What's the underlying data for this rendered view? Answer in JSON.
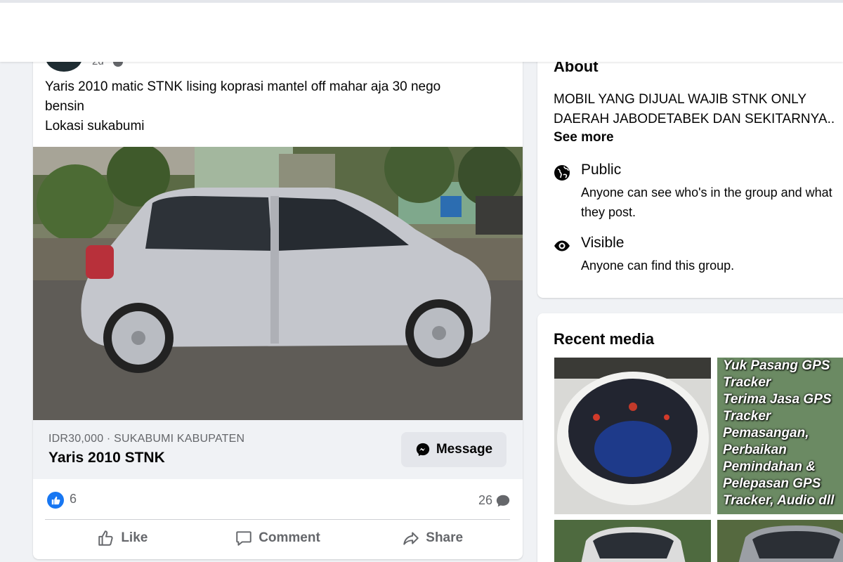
{
  "post": {
    "time": "2d",
    "text_lines": [
      "Yaris 2010 matic STNK lising koprasi mantel off mahar aja 30 nego",
      "bensin",
      "Lokasi sukabumi"
    ],
    "listing": {
      "meta": "IDR30,000 · SUKABUMI KABUPATEN",
      "title": "Yaris 2010 STNK",
      "message_label": "Message"
    },
    "reactions": {
      "likes": "6",
      "comments": "26"
    },
    "actions": {
      "like": "Like",
      "comment": "Comment",
      "share": "Share"
    }
  },
  "about": {
    "title": "About",
    "description_lines": [
      "MOBIL YANG DIJUAL WAJIB STNK ONLY",
      "DAERAH JABODETABEK DAN SEKITARNYA.."
    ],
    "see_more": "See more",
    "public": {
      "title": "Public",
      "description": "Anyone can see who's in the group and what they post."
    },
    "visible": {
      "title": "Visible",
      "description": "Anyone can find this group."
    }
  },
  "recent_media": {
    "title": "Recent media",
    "gps_ad_lines": [
      "Yuk Pasang GPS",
      "Tracker",
      "Terima Jasa GPS",
      "Tracker",
      "Pemasangan,",
      "Perbaikan",
      "Pemindahan &",
      "Pelepasan GPS",
      "Tracker, Audio dll"
    ]
  },
  "colors": {
    "brand_blue": "#1877f2",
    "page_bg": "#f0f2f5",
    "secondary_text": "#65676b"
  }
}
